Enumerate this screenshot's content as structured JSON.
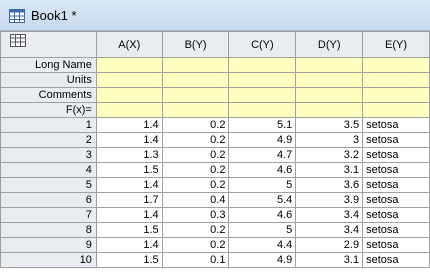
{
  "window": {
    "title": "Book1 *"
  },
  "columns": [
    {
      "key": "A",
      "label": "A(X)"
    },
    {
      "key": "B",
      "label": "B(Y)"
    },
    {
      "key": "C",
      "label": "C(Y)"
    },
    {
      "key": "D",
      "label": "D(Y)"
    },
    {
      "key": "E",
      "label": "E(Y)"
    }
  ],
  "meta_rows": [
    "Long Name",
    "Units",
    "Comments",
    "F(x)="
  ],
  "rows": [
    {
      "n": "1",
      "a": "1.4",
      "b": "0.2",
      "c": "5.1",
      "d": "3.5",
      "e": "setosa"
    },
    {
      "n": "2",
      "a": "1.4",
      "b": "0.2",
      "c": "4.9",
      "d": "3",
      "e": "setosa"
    },
    {
      "n": "3",
      "a": "1.3",
      "b": "0.2",
      "c": "4.7",
      "d": "3.2",
      "e": "setosa"
    },
    {
      "n": "4",
      "a": "1.5",
      "b": "0.2",
      "c": "4.6",
      "d": "3.1",
      "e": "setosa"
    },
    {
      "n": "5",
      "a": "1.4",
      "b": "0.2",
      "c": "5",
      "d": "3.6",
      "e": "setosa"
    },
    {
      "n": "6",
      "a": "1.7",
      "b": "0.4",
      "c": "5.4",
      "d": "3.9",
      "e": "setosa"
    },
    {
      "n": "7",
      "a": "1.4",
      "b": "0.3",
      "c": "4.6",
      "d": "3.4",
      "e": "setosa"
    },
    {
      "n": "8",
      "a": "1.5",
      "b": "0.2",
      "c": "5",
      "d": "3.4",
      "e": "setosa"
    },
    {
      "n": "9",
      "a": "1.4",
      "b": "0.2",
      "c": "4.4",
      "d": "2.9",
      "e": "setosa"
    },
    {
      "n": "10",
      "a": "1.5",
      "b": "0.1",
      "c": "4.9",
      "d": "3.1",
      "e": "setosa"
    }
  ],
  "icons": {
    "app": "worksheet-icon",
    "corner": "sheet-select-icon"
  },
  "colors": {
    "header_bg": "#e9edf1",
    "meta_bg": "#ffffc0",
    "title_bg": "#dbe8f6"
  }
}
